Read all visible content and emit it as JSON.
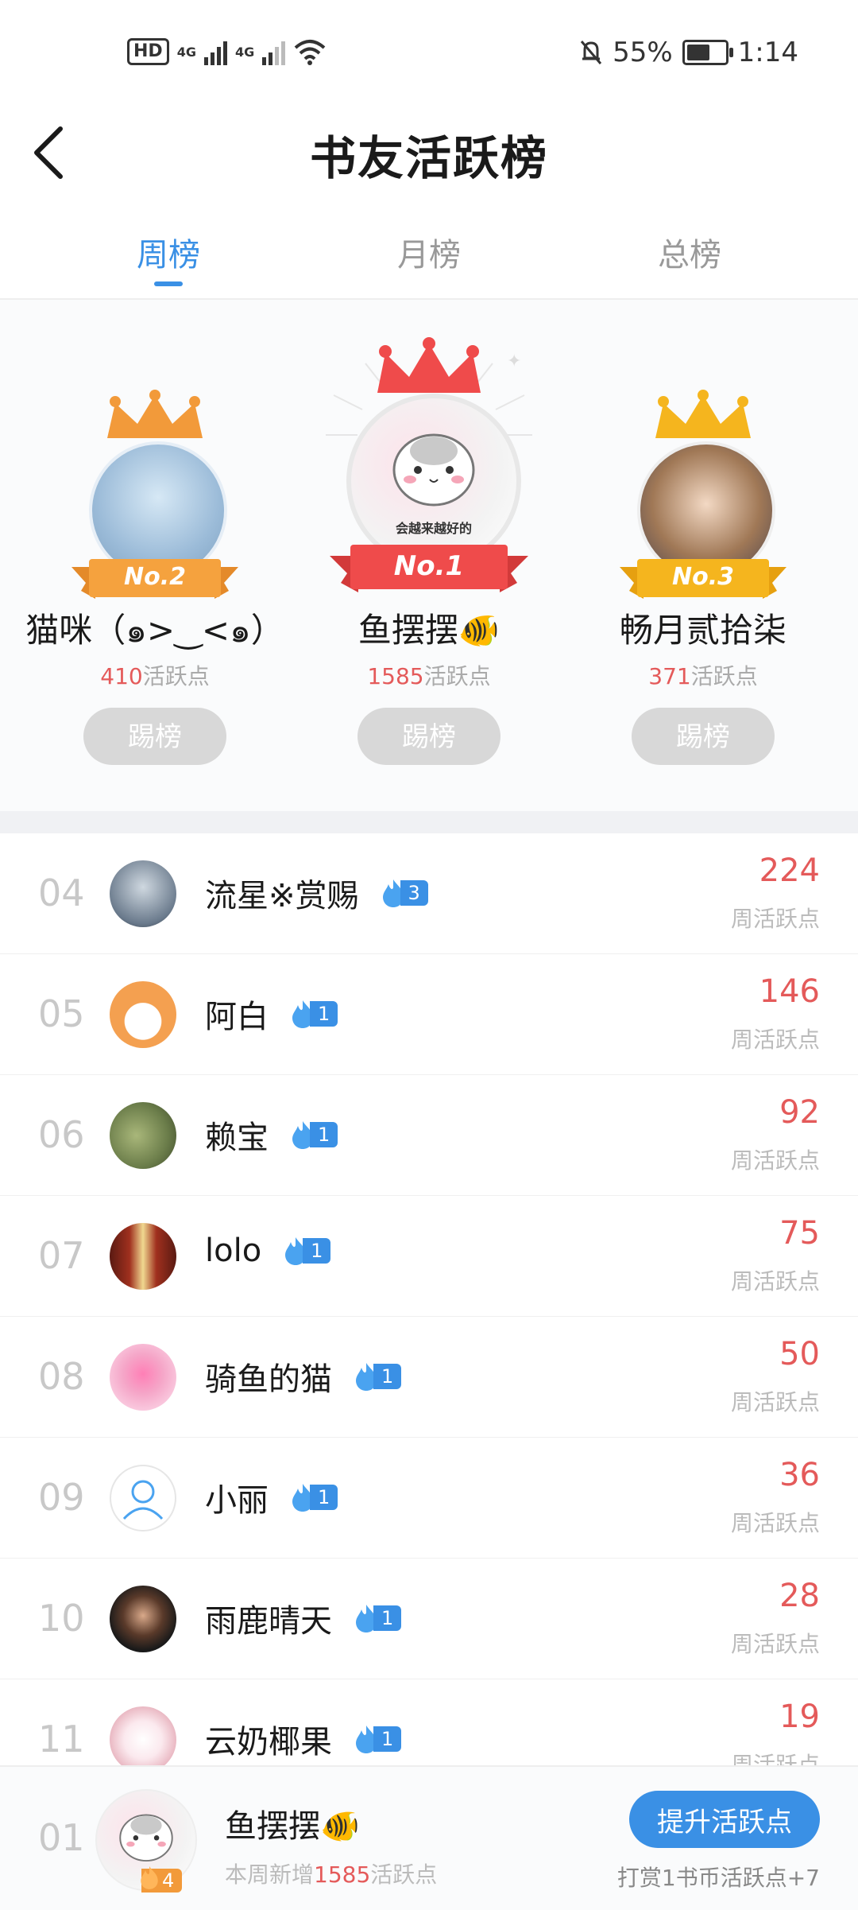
{
  "status": {
    "battery": "55%",
    "time": "1:14",
    "network1": "4G",
    "network2": "4G",
    "hd": "HD"
  },
  "header": {
    "title": "书友活跃榜"
  },
  "tabs": [
    {
      "label": "周榜",
      "active": true
    },
    {
      "label": "月榜"
    },
    {
      "label": "总榜"
    }
  ],
  "podium": [
    {
      "rank_badge": "No.2",
      "name": "猫咪（๑>‿<๑）",
      "points": "410",
      "points_suffix": "活跃点",
      "action": "踢榜",
      "crown_color": "#f29a3a"
    },
    {
      "rank_badge": "No.1",
      "name": "鱼摆摆🐠",
      "avatar_caption": "会越来越好的",
      "points": "1585",
      "points_suffix": "活跃点",
      "action": "踢榜",
      "crown_color": "#ef4b4b"
    },
    {
      "rank_badge": "No.3",
      "name": "畅月贰拾柒",
      "points": "371",
      "points_suffix": "活跃点",
      "action": "踢榜",
      "crown_color": "#f5b51e"
    }
  ],
  "list": [
    {
      "rank": "04",
      "name": "流星※赏赐",
      "level": "3",
      "score": "224",
      "score_label": "周活跃点",
      "avatar_color": "#6a7a8c"
    },
    {
      "rank": "05",
      "name": "阿白",
      "level": "1",
      "score": "146",
      "score_label": "周活跃点",
      "avatar_color": "#f4a050"
    },
    {
      "rank": "06",
      "name": "赖宝",
      "level": "1",
      "score": "92",
      "score_label": "周活跃点",
      "avatar_color": "#6b7d4a"
    },
    {
      "rank": "07",
      "name": "lolo",
      "level": "1",
      "score": "75",
      "score_label": "周活跃点",
      "avatar_color": "#a0301e"
    },
    {
      "rank": "08",
      "name": "骑鱼的猫",
      "level": "1",
      "score": "50",
      "score_label": "周活跃点",
      "avatar_color": "#f5a6c8"
    },
    {
      "rank": "09",
      "name": "小丽",
      "level": "1",
      "score": "36",
      "score_label": "周活跃点",
      "avatar_color": "#ffffff"
    },
    {
      "rank": "10",
      "name": "雨鹿晴天",
      "level": "1",
      "score": "28",
      "score_label": "周活跃点",
      "avatar_color": "#2a2a2a"
    },
    {
      "rank": "11",
      "name": "云奶椰果",
      "level": "1",
      "score": "19",
      "score_label": "周活跃点",
      "avatar_color": "#d98a9a"
    }
  ],
  "footer": {
    "rank": "01",
    "name": "鱼摆摆🐠",
    "level": "4",
    "sub_prefix": "本周新增",
    "sub_points": "1585",
    "sub_suffix": "活跃点",
    "boost_button": "提升活跃点",
    "reward_text": "打赏1书币活跃点+7"
  },
  "colors": {
    "accent": "#3a90e5",
    "score": "#e45a5a",
    "gold": "#f5b51e"
  }
}
